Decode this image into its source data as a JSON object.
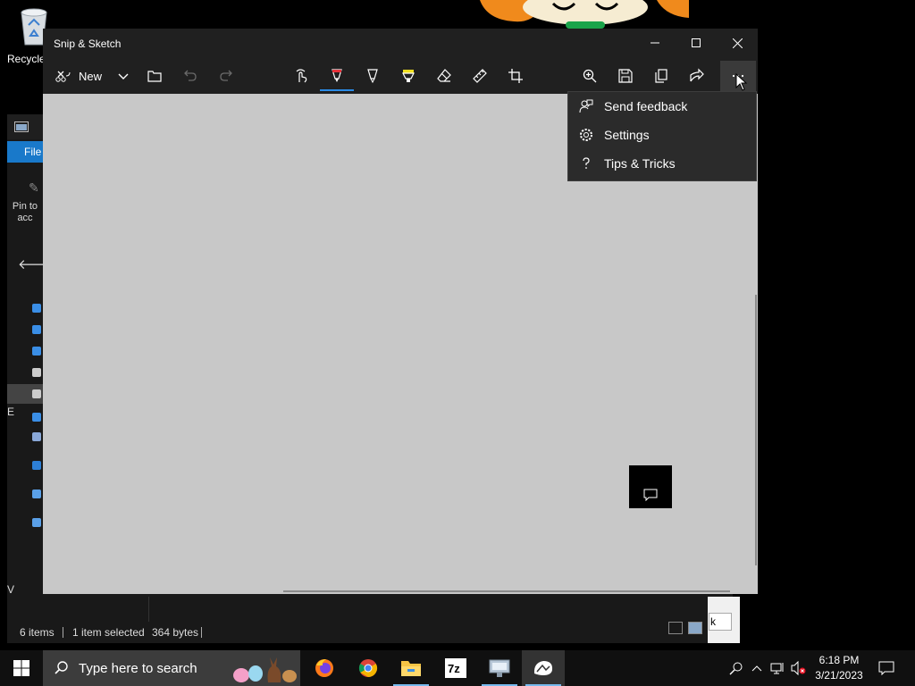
{
  "desktop": {
    "recycle_bin_label": "Recycle"
  },
  "explorer": {
    "file_tab": "File",
    "pin_label_1": "Pin to",
    "pin_label_2": "acc",
    "edge_letter_1": "E",
    "edge_letter_2": "V",
    "status_items": "6 items",
    "status_selected": "1 item selected",
    "status_size": "364 bytes",
    "dialog_button_text": "k"
  },
  "snip": {
    "title": "Snip & Sketch",
    "new_label": "New",
    "tools": [
      "touch-writing-icon",
      "ballpoint-pen-icon",
      "pencil-icon",
      "highlighter-icon",
      "eraser-icon",
      "ruler-icon",
      "crop-icon"
    ],
    "actions": [
      "zoom-icon",
      "save-icon",
      "copy-icon",
      "share-icon",
      "more-icon"
    ],
    "menu": {
      "items": [
        {
          "label": "Send feedback",
          "icon": "feedback-icon"
        },
        {
          "label": "Settings",
          "icon": "gear-icon"
        },
        {
          "label": "Tips & Tricks",
          "icon": "question-icon"
        }
      ]
    },
    "colors": {
      "accent": "#2a8ae5",
      "canvas": "#c8c8c8",
      "highlighter": "#f0e020",
      "pen": "#e8343c"
    }
  },
  "taskbar": {
    "search_placeholder": "Type here to search",
    "apps": [
      "firefox-icon",
      "chrome-icon",
      "file-explorer-icon",
      "7zip-icon",
      "network-app-icon",
      "snip-sketch-icon"
    ],
    "time": "6:18 PM",
    "date": "3/21/2023"
  }
}
